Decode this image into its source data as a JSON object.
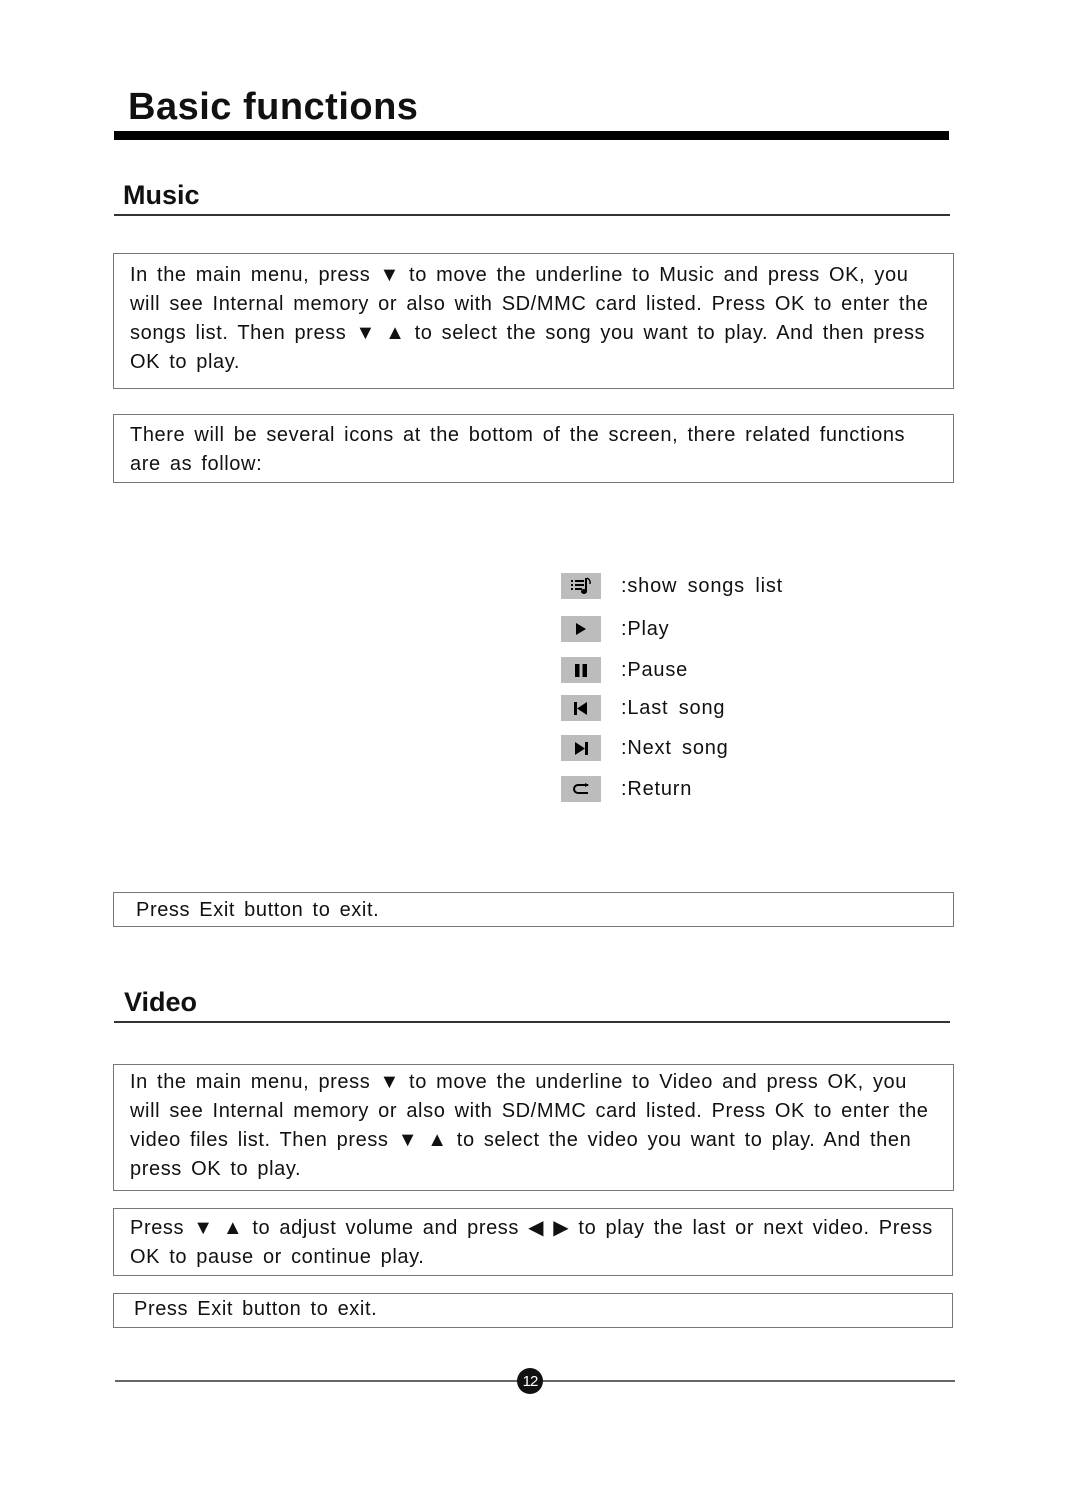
{
  "page": {
    "title": "Basic functions",
    "page_number": "12"
  },
  "music": {
    "title": "Music",
    "intro": "In the main menu, press ▼ to move the underline to Music and press OK, you will see Internal memory or also with SD/MMC card listed. Press OK to enter the songs list. Then press ▼ ▲ to select the song you want to play. And then press OK to play.",
    "icons_note": "There will be several icons at the bottom of the screen, there related functions are as follow:",
    "legend": [
      {
        "icon": "songs-list-icon",
        "glyph": "≡♪",
        "label": ":show songs list"
      },
      {
        "icon": "play-icon",
        "glyph": "▶",
        "label": ":Play"
      },
      {
        "icon": "pause-icon",
        "glyph": "❚❚",
        "label": ":Pause"
      },
      {
        "icon": "previous-track-icon",
        "glyph": "⏮",
        "label": ":Last song"
      },
      {
        "icon": "next-track-icon",
        "glyph": "⏭",
        "label": ":Next song"
      },
      {
        "icon": "return-icon",
        "glyph": "⊂",
        "label": ":Return"
      }
    ],
    "exit_note": "Press Exit button to exit."
  },
  "video": {
    "title": "Video",
    "intro": "In the main menu, press ▼ to move the underline to Video and press OK, you will see Internal memory or also with SD/MMC card listed. Press OK to enter the video files list. Then press ▼ ▲ to select the video you want to play. And then press OK to play.",
    "controls_note": "Press ▼ ▲ to adjust volume and press ◀ ▶ to play the last or next video. Press OK to pause or continue play.",
    "exit_note": "Press Exit button to exit."
  }
}
